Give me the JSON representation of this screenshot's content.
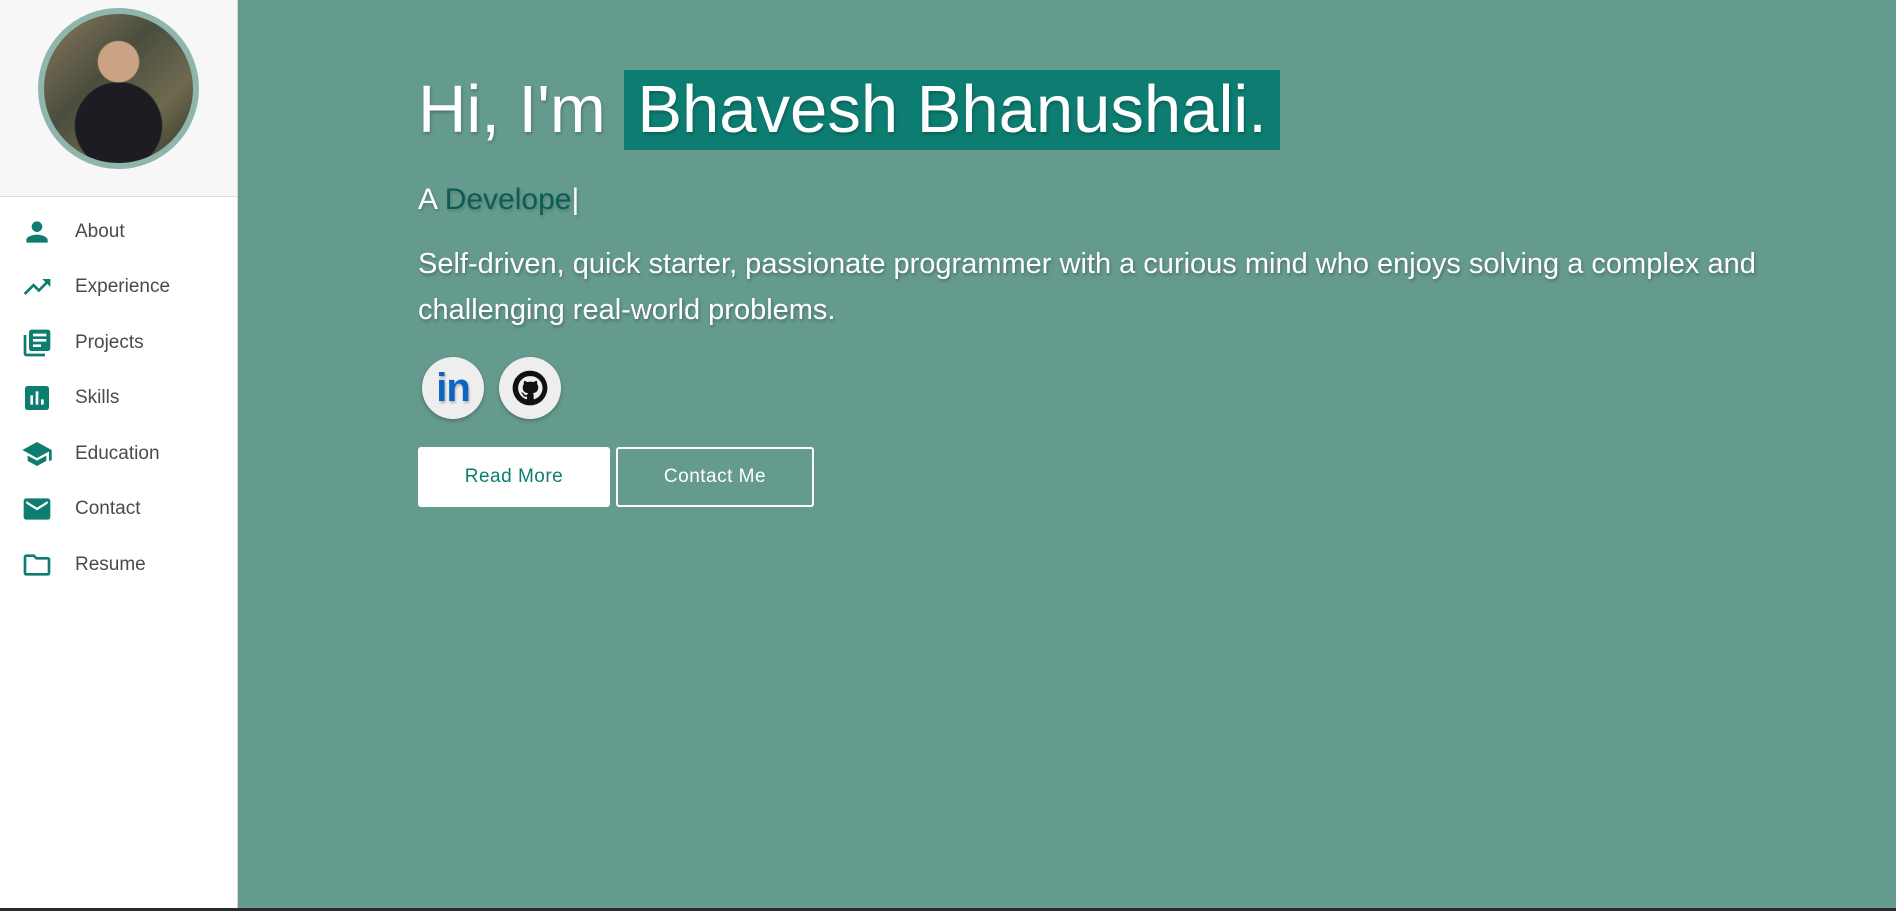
{
  "sidebar": {
    "items": [
      {
        "label": "About",
        "icon": "person-icon"
      },
      {
        "label": "Experience",
        "icon": "trending-up-icon"
      },
      {
        "label": "Projects",
        "icon": "library-books-icon"
      },
      {
        "label": "Skills",
        "icon": "bar-chart-icon"
      },
      {
        "label": "Education",
        "icon": "school-icon"
      },
      {
        "label": "Contact",
        "icon": "mail-icon"
      },
      {
        "label": "Resume",
        "icon": "folder-icon"
      }
    ]
  },
  "hero": {
    "greeting": "Hi, I'm ",
    "name": "Bhavesh Bhanushali.",
    "role_prefix": "A ",
    "role_typed": "Develope",
    "cursor": "|",
    "bio": "Self-driven, quick starter, passionate programmer with a curious mind who enjoys solving a complex and challenging real-world problems.",
    "linkedin_glyph": "in",
    "read_more_label": "Read More",
    "contact_label": "Contact Me"
  },
  "colors": {
    "accent": "#0d7d72",
    "hero_bg": "#659b8e",
    "typed_text": "#0b5c52"
  }
}
